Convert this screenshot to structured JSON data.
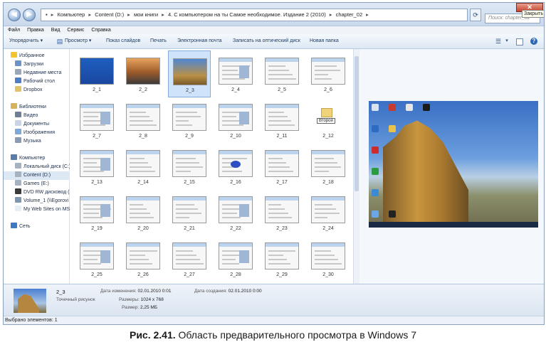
{
  "window": {
    "breadcrumb": [
      "Компьютер",
      "Content (D:)",
      "мои книги",
      "4. С компьютером на ты Самое необходимое. Издание 2 (2010)",
      "chapter_02"
    ],
    "search_placeholder": "Поиск: chapter_02",
    "close_tooltip": "Закрыть"
  },
  "menu": [
    "Файл",
    "Правка",
    "Вид",
    "Сервис",
    "Справка"
  ],
  "commands": {
    "organize": "Упорядочить",
    "view": "Просмотр",
    "slideshow": "Показ слайдов",
    "print": "Печать",
    "email": "Электронная почта",
    "burn": "Записать на оптический диск",
    "new_folder": "Новая папка"
  },
  "nav": {
    "favorites": {
      "label": "Избранное",
      "items": [
        "Загрузки",
        "Недавние места",
        "Рабочий стол",
        "Dropbox"
      ]
    },
    "libraries": {
      "label": "Библиотеки",
      "items": [
        "Видео",
        "Документы",
        "Изображения",
        "Музыка"
      ]
    },
    "computer": {
      "label": "Компьютер",
      "items": [
        "Локальный диск (C:)",
        "Content (D:)",
        "Games (E:)",
        "DVD RW дисковод (",
        "Volume_1 (\\\\Egorovi",
        "My Web Sites on MS"
      ]
    },
    "network": {
      "label": "Сеть"
    }
  },
  "files": [
    "2_1",
    "2_2",
    "2_3",
    "2_4",
    "2_5",
    "2_6",
    "2_7",
    "2_8",
    "2_9",
    "2_10",
    "2_11",
    "2_12",
    "2_13",
    "2_14",
    "2_15",
    "2_16",
    "2_17",
    "2_18",
    "2_19",
    "2_20",
    "2_21",
    "2_22",
    "2_23",
    "2_24",
    "2_25",
    "2_26",
    "2_27",
    "2_28",
    "2_29",
    "2_30"
  ],
  "selected_file": "2_3",
  "thumb_label_2_12": "Второй",
  "details": {
    "name": "2_3",
    "type": "Точечный рисунок",
    "modified_label": "Дата изменения:",
    "modified": "02.01.2010 0:01",
    "created_label": "Дата создания:",
    "created": "02.01.2010 0:00",
    "dimensions_label": "Размеры:",
    "dimensions": "1024 x 768",
    "size_label": "Размер:",
    "size": "2,25 МБ"
  },
  "status": "Выбрано элементов: 1",
  "caption": {
    "number": "Рис. 2.41.",
    "text": "Область предварительного просмотра в Windows 7"
  }
}
